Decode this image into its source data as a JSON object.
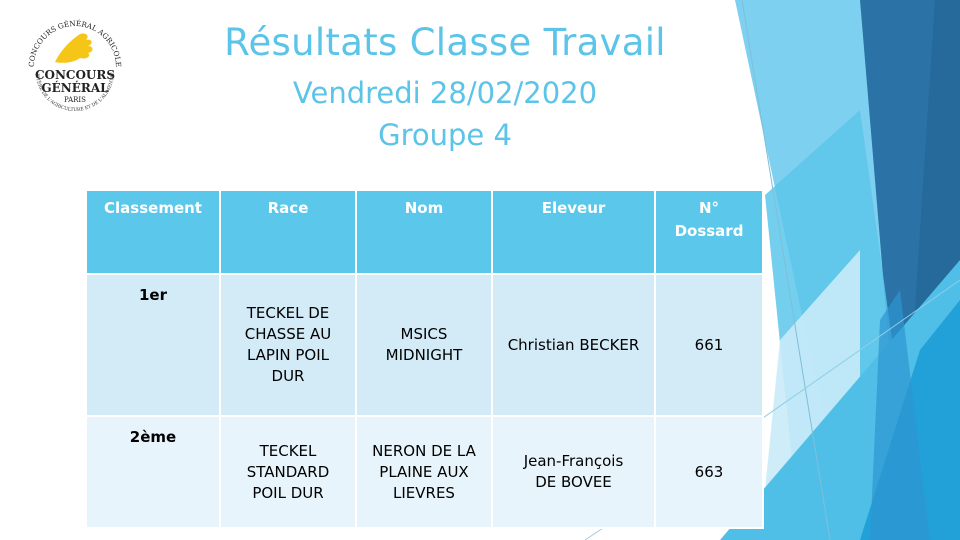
{
  "slide": {
    "logo": {
      "arc_text_top": "CONCOURS GÉNÉRAL AGRICOLE",
      "main_line1": "CONCOURS",
      "main_line2": "GÉNÉRAL",
      "city": "PARIS",
      "arc_text_bottom": "MINISTÈRE DE L'AGRICULTURE ET DE L'ALIMENTATION",
      "leaf_color": "#f5c518"
    },
    "title": "Résultats Classe Travail",
    "subtitle_date": "Vendredi 28/02/2020",
    "subtitle_group": "Groupe 4"
  },
  "table": {
    "headers": [
      "Classement",
      "Race",
      "Nom",
      "Eleveur",
      "N° Dossard"
    ],
    "rows": [
      {
        "rank": "1er",
        "race": "TECKEL DE CHASSE AU LAPIN POIL DUR",
        "nom": "MSICS MIDNIGHT",
        "eleveur": "Christian BECKER",
        "dossard": "661"
      },
      {
        "rank": "2ème",
        "race": "TECKEL STANDARD POIL DUR",
        "nom": "NERON DE LA PLAINE AUX LIEVRES",
        "eleveur": "Jean-François DE BOVEE",
        "dossard": "663"
      }
    ]
  },
  "colors": {
    "accent": "#5bc4e8",
    "header_bg": "#5bc8eb",
    "row1_bg": "#d3eaf7",
    "row2_bg": "#e8f4fb",
    "deco_dark": "#2a6a9c",
    "deco_mid": "#2fa7d9",
    "deco_light": "#7dd0ef"
  }
}
